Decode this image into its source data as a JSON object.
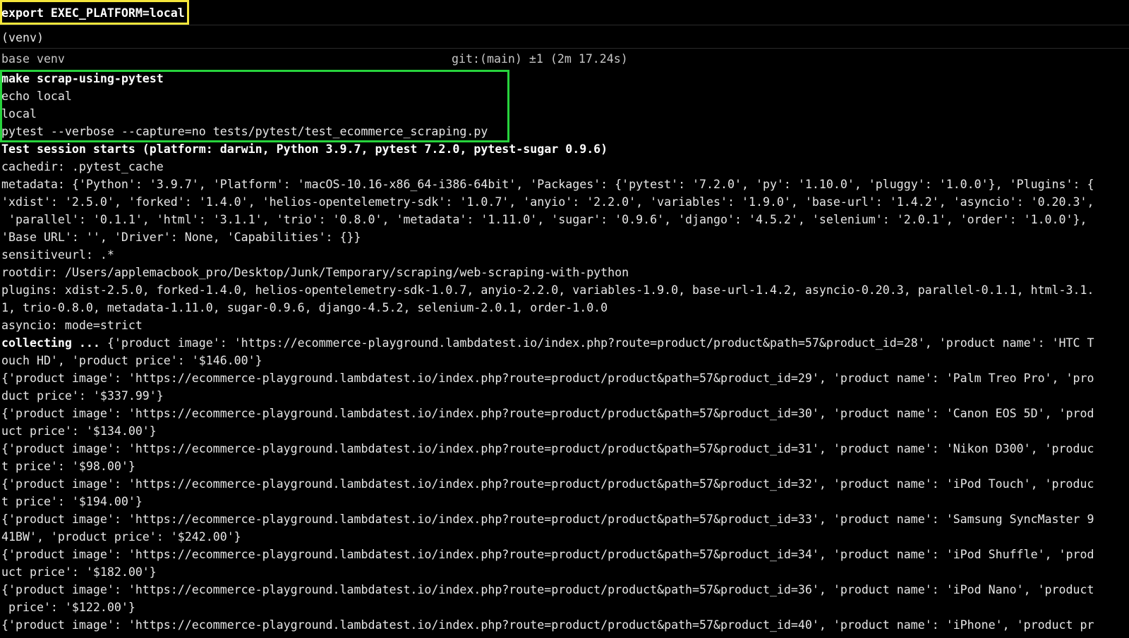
{
  "terminal": {
    "command_export": "export EXEC_PLATFORM=local",
    "venv_marker": "(venv)",
    "prompt_left": "base venv",
    "prompt_right": "git:(main) ±1 (2m 17.24s)",
    "make_command": "make scrap-using-pytest",
    "echo_line": "echo local",
    "echo_output": "local",
    "pytest_command": "pytest --verbose --capture=no tests/pytest/test_ecommerce_scraping.py",
    "session_start": "Test session starts (platform: darwin, Python 3.9.7, pytest 7.2.0, pytest-sugar 0.9.6)",
    "cachedir": "cachedir: .pytest_cache",
    "metadata_1": "metadata: {'Python': '3.9.7', 'Platform': 'macOS-10.16-x86_64-i386-64bit', 'Packages': {'pytest': '7.2.0', 'py': '1.10.0', 'pluggy': '1.0.0'}, 'Plugins': {",
    "metadata_2": "'xdist': '2.5.0', 'forked': '1.4.0', 'helios-opentelemetry-sdk': '1.0.7', 'anyio': '2.2.0', 'variables': '1.9.0', 'base-url': '1.4.2', 'asyncio': '0.20.3',",
    "metadata_3": " 'parallel': '0.1.1', 'html': '3.1.1', 'trio': '0.8.0', 'metadata': '1.11.0', 'sugar': '0.9.6', 'django': '4.5.2', 'selenium': '2.0.1', 'order': '1.0.0'},",
    "metadata_4": "'Base URL': '', 'Driver': None, 'Capabilities': {}}",
    "sensitiveurl": "sensitiveurl: .*",
    "rootdir": "rootdir: /Users/applemacbook_pro/Desktop/Junk/Temporary/scraping/web-scraping-with-python",
    "plugins_1": "plugins: xdist-2.5.0, forked-1.4.0, helios-opentelemetry-sdk-1.0.7, anyio-2.2.0, variables-1.9.0, base-url-1.4.2, asyncio-0.20.3, parallel-0.1.1, html-3.1.",
    "plugins_2": "1, trio-0.8.0, metadata-1.11.0, sugar-0.9.6, django-4.5.2, selenium-2.0.1, order-1.0.0",
    "asyncio_mode": "asyncio: mode=strict",
    "collecting_label": "collecting ...",
    "collecting_rest": " {'product image': 'https://ecommerce-playground.lambdatest.io/index.php?route=product/product&path=57&product_id=28', 'product name': 'HTC T",
    "out_1b": "ouch HD', 'product price': '$146.00'}",
    "out_2a": "{'product image': 'https://ecommerce-playground.lambdatest.io/index.php?route=product/product&path=57&product_id=29', 'product name': 'Palm Treo Pro', 'pro",
    "out_2b": "duct price': '$337.99'}",
    "out_3a": "{'product image': 'https://ecommerce-playground.lambdatest.io/index.php?route=product/product&path=57&product_id=30', 'product name': 'Canon EOS 5D', 'prod",
    "out_3b": "uct price': '$134.00'}",
    "out_4a": "{'product image': 'https://ecommerce-playground.lambdatest.io/index.php?route=product/product&path=57&product_id=31', 'product name': 'Nikon D300', 'produc",
    "out_4b": "t price': '$98.00'}",
    "out_5a": "{'product image': 'https://ecommerce-playground.lambdatest.io/index.php?route=product/product&path=57&product_id=32', 'product name': 'iPod Touch', 'produc",
    "out_5b": "t price': '$194.00'}",
    "out_6a": "{'product image': 'https://ecommerce-playground.lambdatest.io/index.php?route=product/product&path=57&product_id=33', 'product name': 'Samsung SyncMaster 9",
    "out_6b": "41BW', 'product price': '$242.00'}",
    "out_7a": "{'product image': 'https://ecommerce-playground.lambdatest.io/index.php?route=product/product&path=57&product_id=34', 'product name': 'iPod Shuffle', 'prod",
    "out_7b": "uct price': '$182.00'}",
    "out_8a": "{'product image': 'https://ecommerce-playground.lambdatest.io/index.php?route=product/product&path=57&product_id=36', 'product name': 'iPod Nano', 'product",
    "out_8b": " price': '$122.00'}",
    "out_9a": "{'product image': 'https://ecommerce-playground.lambdatest.io/index.php?route=product/product&path=57&product_id=40', 'product name': 'iPhone', 'product pr"
  },
  "colors": {
    "background": "#000000",
    "text": "#e6e6e6",
    "highlight_yellow": "#f5e63b",
    "highlight_green": "#27d33c"
  }
}
